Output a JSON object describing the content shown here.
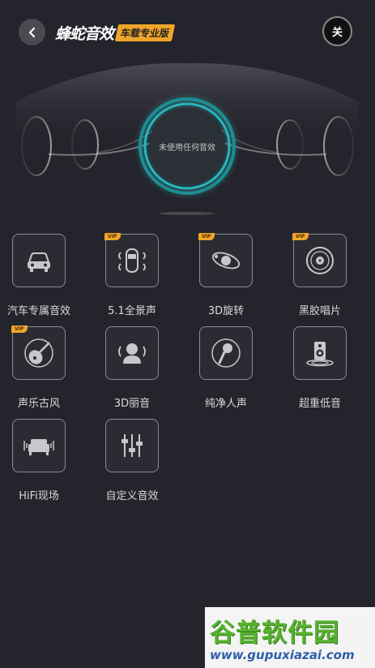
{
  "header": {
    "logo_text": "蜂蛇音效",
    "logo_badge": "车载专业版",
    "close_label": "关"
  },
  "hero": {
    "status_text": "未使用任何音效"
  },
  "effects": [
    {
      "label": "汽车专属音效",
      "icon": "car-icon",
      "vip": false
    },
    {
      "label": "5.1全景声",
      "icon": "car-surround-icon",
      "vip": true
    },
    {
      "label": "3D旋转",
      "icon": "orbit-icon",
      "vip": true
    },
    {
      "label": "黑胶唱片",
      "icon": "vinyl-record-icon",
      "vip": true
    },
    {
      "label": "声乐古风",
      "icon": "pipa-icon",
      "vip": true
    },
    {
      "label": "3D丽音",
      "icon": "user-sound-icon",
      "vip": false
    },
    {
      "label": "纯净人声",
      "icon": "microphone-icon",
      "vip": false
    },
    {
      "label": "超重低音",
      "icon": "speaker-icon",
      "vip": false
    },
    {
      "label": "HiFi现场",
      "icon": "sofa-icon",
      "vip": false
    },
    {
      "label": "自定义音效",
      "icon": "equalizer-icon",
      "vip": false
    }
  ],
  "vip_label": "VIP",
  "watermark": {
    "title": "谷普软件园",
    "url": "www.gupuxiazai.com"
  },
  "colors": {
    "background": "#24242c",
    "accent_gold": "#f0a52a",
    "ring_teal": "#1fa3a8"
  }
}
